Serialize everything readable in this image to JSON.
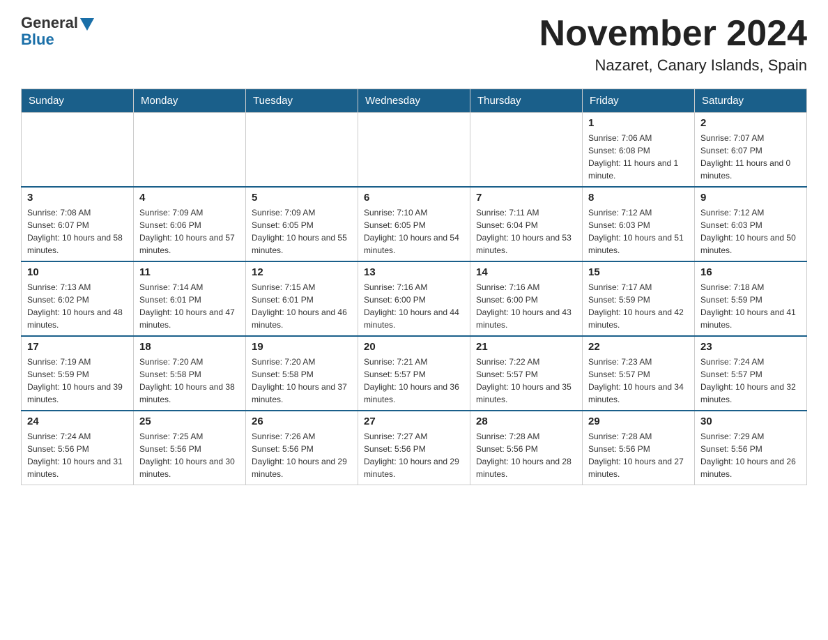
{
  "logo": {
    "general": "General",
    "blue": "Blue"
  },
  "title": "November 2024",
  "subtitle": "Nazaret, Canary Islands, Spain",
  "days_of_week": [
    "Sunday",
    "Monday",
    "Tuesday",
    "Wednesday",
    "Thursday",
    "Friday",
    "Saturday"
  ],
  "weeks": [
    [
      {
        "day": "",
        "info": ""
      },
      {
        "day": "",
        "info": ""
      },
      {
        "day": "",
        "info": ""
      },
      {
        "day": "",
        "info": ""
      },
      {
        "day": "",
        "info": ""
      },
      {
        "day": "1",
        "info": "Sunrise: 7:06 AM\nSunset: 6:08 PM\nDaylight: 11 hours and 1 minute."
      },
      {
        "day": "2",
        "info": "Sunrise: 7:07 AM\nSunset: 6:07 PM\nDaylight: 11 hours and 0 minutes."
      }
    ],
    [
      {
        "day": "3",
        "info": "Sunrise: 7:08 AM\nSunset: 6:07 PM\nDaylight: 10 hours and 58 minutes."
      },
      {
        "day": "4",
        "info": "Sunrise: 7:09 AM\nSunset: 6:06 PM\nDaylight: 10 hours and 57 minutes."
      },
      {
        "day": "5",
        "info": "Sunrise: 7:09 AM\nSunset: 6:05 PM\nDaylight: 10 hours and 55 minutes."
      },
      {
        "day": "6",
        "info": "Sunrise: 7:10 AM\nSunset: 6:05 PM\nDaylight: 10 hours and 54 minutes."
      },
      {
        "day": "7",
        "info": "Sunrise: 7:11 AM\nSunset: 6:04 PM\nDaylight: 10 hours and 53 minutes."
      },
      {
        "day": "8",
        "info": "Sunrise: 7:12 AM\nSunset: 6:03 PM\nDaylight: 10 hours and 51 minutes."
      },
      {
        "day": "9",
        "info": "Sunrise: 7:12 AM\nSunset: 6:03 PM\nDaylight: 10 hours and 50 minutes."
      }
    ],
    [
      {
        "day": "10",
        "info": "Sunrise: 7:13 AM\nSunset: 6:02 PM\nDaylight: 10 hours and 48 minutes."
      },
      {
        "day": "11",
        "info": "Sunrise: 7:14 AM\nSunset: 6:01 PM\nDaylight: 10 hours and 47 minutes."
      },
      {
        "day": "12",
        "info": "Sunrise: 7:15 AM\nSunset: 6:01 PM\nDaylight: 10 hours and 46 minutes."
      },
      {
        "day": "13",
        "info": "Sunrise: 7:16 AM\nSunset: 6:00 PM\nDaylight: 10 hours and 44 minutes."
      },
      {
        "day": "14",
        "info": "Sunrise: 7:16 AM\nSunset: 6:00 PM\nDaylight: 10 hours and 43 minutes."
      },
      {
        "day": "15",
        "info": "Sunrise: 7:17 AM\nSunset: 5:59 PM\nDaylight: 10 hours and 42 minutes."
      },
      {
        "day": "16",
        "info": "Sunrise: 7:18 AM\nSunset: 5:59 PM\nDaylight: 10 hours and 41 minutes."
      }
    ],
    [
      {
        "day": "17",
        "info": "Sunrise: 7:19 AM\nSunset: 5:59 PM\nDaylight: 10 hours and 39 minutes."
      },
      {
        "day": "18",
        "info": "Sunrise: 7:20 AM\nSunset: 5:58 PM\nDaylight: 10 hours and 38 minutes."
      },
      {
        "day": "19",
        "info": "Sunrise: 7:20 AM\nSunset: 5:58 PM\nDaylight: 10 hours and 37 minutes."
      },
      {
        "day": "20",
        "info": "Sunrise: 7:21 AM\nSunset: 5:57 PM\nDaylight: 10 hours and 36 minutes."
      },
      {
        "day": "21",
        "info": "Sunrise: 7:22 AM\nSunset: 5:57 PM\nDaylight: 10 hours and 35 minutes."
      },
      {
        "day": "22",
        "info": "Sunrise: 7:23 AM\nSunset: 5:57 PM\nDaylight: 10 hours and 34 minutes."
      },
      {
        "day": "23",
        "info": "Sunrise: 7:24 AM\nSunset: 5:57 PM\nDaylight: 10 hours and 32 minutes."
      }
    ],
    [
      {
        "day": "24",
        "info": "Sunrise: 7:24 AM\nSunset: 5:56 PM\nDaylight: 10 hours and 31 minutes."
      },
      {
        "day": "25",
        "info": "Sunrise: 7:25 AM\nSunset: 5:56 PM\nDaylight: 10 hours and 30 minutes."
      },
      {
        "day": "26",
        "info": "Sunrise: 7:26 AM\nSunset: 5:56 PM\nDaylight: 10 hours and 29 minutes."
      },
      {
        "day": "27",
        "info": "Sunrise: 7:27 AM\nSunset: 5:56 PM\nDaylight: 10 hours and 29 minutes."
      },
      {
        "day": "28",
        "info": "Sunrise: 7:28 AM\nSunset: 5:56 PM\nDaylight: 10 hours and 28 minutes."
      },
      {
        "day": "29",
        "info": "Sunrise: 7:28 AM\nSunset: 5:56 PM\nDaylight: 10 hours and 27 minutes."
      },
      {
        "day": "30",
        "info": "Sunrise: 7:29 AM\nSunset: 5:56 PM\nDaylight: 10 hours and 26 minutes."
      }
    ]
  ]
}
